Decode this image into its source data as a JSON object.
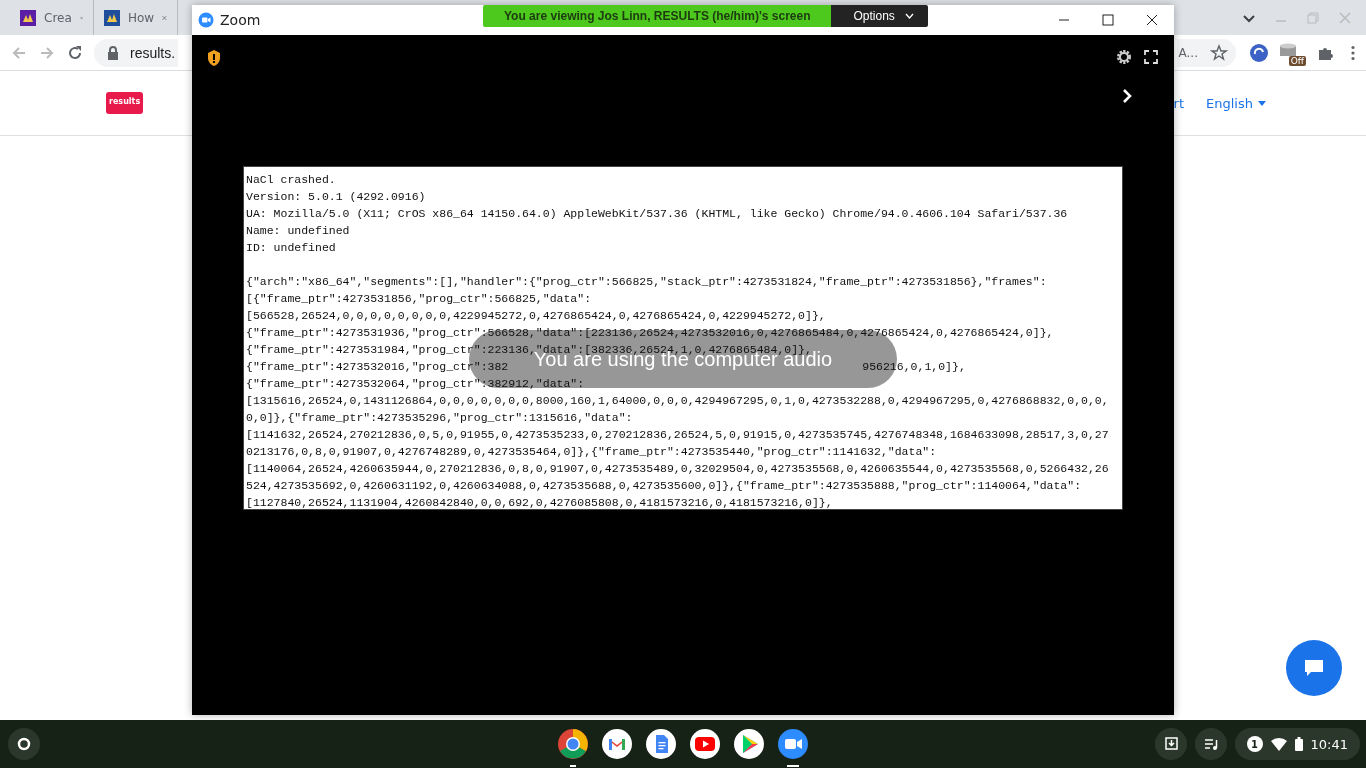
{
  "browser": {
    "tabs": [
      {
        "title": "Crea",
        "kind": "purple"
      },
      {
        "title": "How",
        "kind": "blue"
      }
    ],
    "address": "results.",
    "address_tail": "A...",
    "extension_badge": "Off",
    "page": {
      "logo": "results",
      "nav_link": "rt",
      "language": "English"
    }
  },
  "zoom": {
    "title": "Zoom",
    "banner": "You are viewing Jos Linn, RESULTS (he/him)'s screen",
    "options": "Options",
    "header_lines": [
      "NaCl crashed.",
      "Version: 5.0.1 (4292.0916)",
      "UA: Mozilla/5.0 (X11; CrOS x86_64 14150.64.0) AppleWebKit/537.36 (KHTML, like Gecko) Chrome/94.0.4606.104 Safari/537.36",
      "Name: undefined",
      "ID: undefined"
    ],
    "dump_lines": [
      {
        "kind": "line",
        "text": "{\"arch\":\"x86_64\",\"segments\":[],\"handler\":{\"prog_ctr\":566825,\"stack_ptr\":4273531824,\"frame_ptr\":4273531856},\"frames\":"
      },
      {
        "kind": "line",
        "text": "[{\"frame_ptr\":4273531856,\"prog_ctr\":566825,\"data\":"
      },
      {
        "kind": "line",
        "text": "[566528,26524,0,0,0,0,0,0,0,0,4229945272,0,4276865424,0,4276865424,0,4229945272,0]},"
      },
      {
        "kind": "line",
        "text": "{\"frame_ptr\":4273531936,\"prog_ctr\":566528,\"data\":[223136,26524,4273532016,0,4276865484,0,4276865424,0,4276865424,0]},"
      },
      {
        "kind": "line",
        "text": "{\"frame_ptr\":4273531984,\"prog_ctr\":223136,\"data\":[382336,26524,1,0,4276865484,0]},"
      },
      {
        "kind": "covered",
        "left": "{\"frame_ptr\":4273532016,\"prog_ctr\":382",
        "right": "956216,0,1,0]},"
      },
      {
        "kind": "line",
        "text": "{\"frame_ptr\":4273532064,\"prog_ctr\":382912,\"data\":"
      },
      {
        "kind": "line",
        "text": "[1315616,26524,0,1431126864,0,0,0,0,0,0,0,8000,160,1,64000,0,0,0,4294967295,0,1,0,4273532288,0,4294967295,0,4276868832,0,0,0,"
      },
      {
        "kind": "line",
        "text": "0,0]},{\"frame_ptr\":4273535296,\"prog_ctr\":1315616,\"data\":"
      },
      {
        "kind": "line",
        "text": "[1141632,26524,270212836,0,5,0,91955,0,4273535233,0,270212836,26524,5,0,91915,0,4273535745,4276748348,1684633098,28517,3,0,27"
      },
      {
        "kind": "line",
        "text": "0213176,0,8,0,91907,0,4276748289,0,4273535464,0]},{\"frame_ptr\":4273535440,\"prog_ctr\":1141632,\"data\":"
      },
      {
        "kind": "line",
        "text": "[1140064,26524,4260635944,0,270212836,0,8,0,91907,0,4273535489,0,32029504,0,4273535568,0,4260635544,0,4273535568,0,5266432,26"
      },
      {
        "kind": "line",
        "text": "524,4273535692,0,4260631192,0,4260634088,0,4273535688,0,4273535600,0]},{\"frame_ptr\":4273535888,\"prog_ctr\":1140064,\"data\":"
      },
      {
        "kind": "line",
        "text": "[1127840,26524,1131904,4260842840,0,0,692,0,4276085808,0,4181573216,0,4181573216,0]},"
      }
    ],
    "toast": "You are using the computer audio"
  },
  "shelf": {
    "apps": [
      {
        "kind": "chrome",
        "open": true
      },
      {
        "kind": "gmail",
        "open": false
      },
      {
        "kind": "docs",
        "open": false
      },
      {
        "kind": "youtube",
        "open": false
      },
      {
        "kind": "play",
        "open": false
      },
      {
        "kind": "zoom",
        "open": true
      }
    ],
    "notification_count": "1",
    "time": "10:41"
  }
}
